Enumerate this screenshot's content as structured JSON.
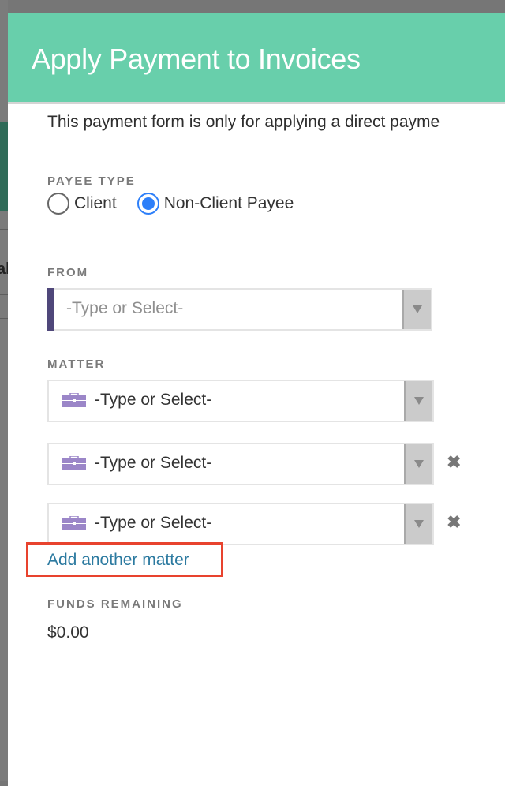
{
  "background": {
    "partial_text": "al"
  },
  "modal": {
    "title": "Apply Payment to Invoices",
    "intro": "This payment form is only for applying a direct payme",
    "payee_type": {
      "label": "PAYEE TYPE",
      "options": [
        {
          "label": "Client",
          "checked": false
        },
        {
          "label": "Non-Client Payee",
          "checked": true
        }
      ]
    },
    "from": {
      "label": "FROM",
      "placeholder": "-Type or Select-"
    },
    "matter": {
      "label": "MATTER",
      "rows": [
        {
          "placeholder": "-Type or Select-",
          "icon": "briefcase-icon",
          "removable": false
        },
        {
          "placeholder": "-Type or Select-",
          "icon": "briefcase-icon",
          "removable": true,
          "remove_glyph": "✖"
        },
        {
          "placeholder": "-Type or Select-",
          "icon": "briefcase-icon",
          "removable": true,
          "remove_glyph": "✖"
        }
      ],
      "add_link": "Add another matter"
    },
    "funds_remaining": {
      "label": "FUNDS REMAINING",
      "value": "$0.00"
    }
  },
  "colors": {
    "header": "#68cfab",
    "radio_selected": "#2d7ff9",
    "link": "#2c7aa0",
    "highlight_box": "#e8432e",
    "briefcase": "#9b86c8",
    "from_accent": "#4f477a"
  }
}
